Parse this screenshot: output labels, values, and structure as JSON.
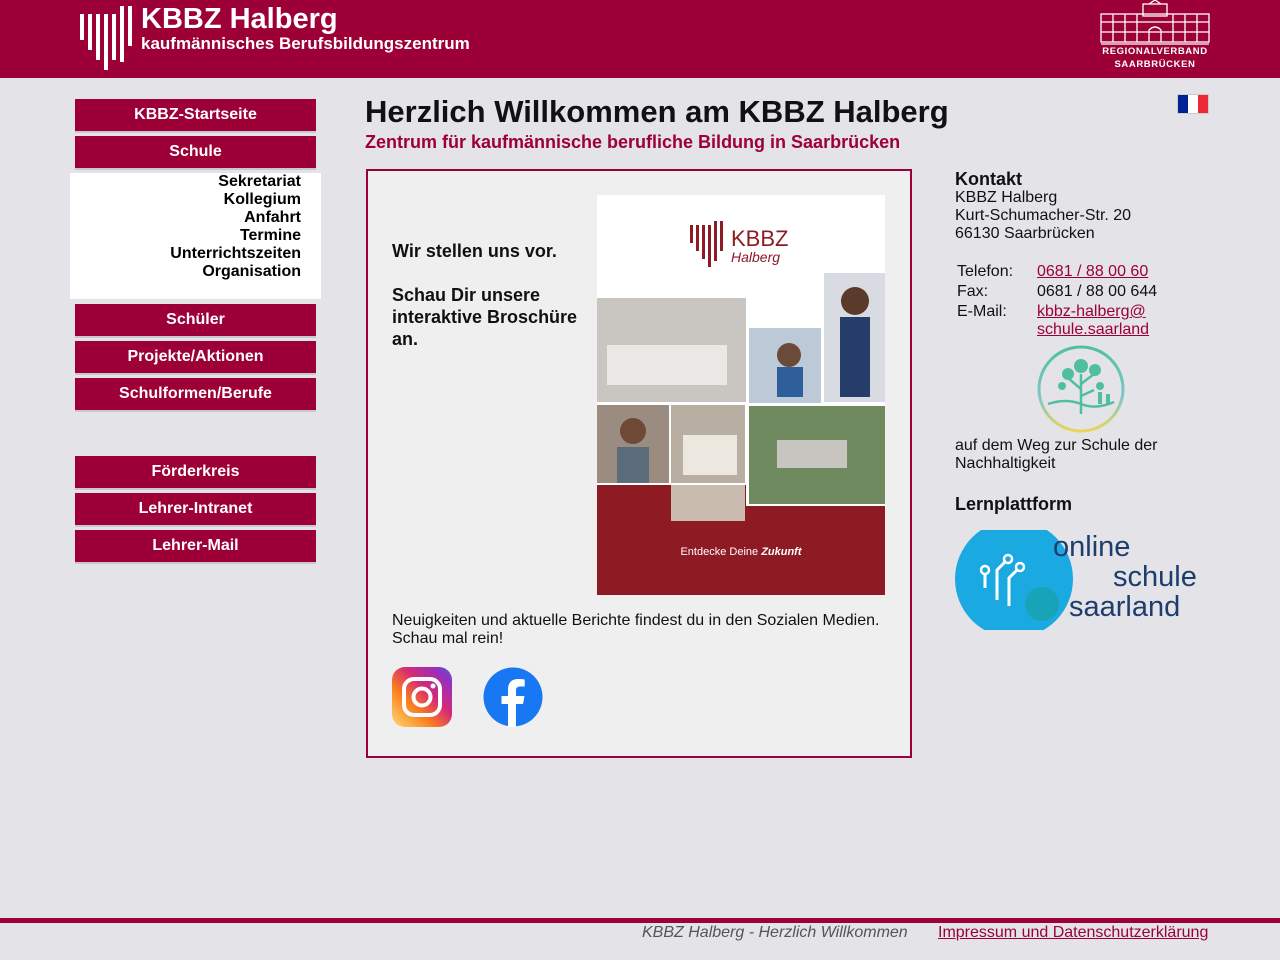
{
  "header": {
    "title": "KBBZ Halberg",
    "subtitle": "kaufmännisches Berufsbildungszentrum",
    "partner_line1": "REGIONALVERBAND",
    "partner_line2": "SAARBRÜCKEN"
  },
  "nav": {
    "startseite": "KBBZ-Startseite",
    "schule": "Schule",
    "schule_sub": [
      "Sekretariat",
      "Kollegium",
      "Anfahrt",
      "Termine",
      "Unterrichtszeiten",
      "Organisation"
    ],
    "schueler": "Schüler",
    "projekte": "Projekte/Aktionen",
    "schulformen": "Schulformen/Berufe",
    "foerderkreis": "Förderkreis",
    "intranet": "Lehrer-Intranet",
    "mail": "Lehrer-Mail"
  },
  "main": {
    "title": "Herzlich Willkommen am KBBZ Halberg",
    "subtitle": "Zentrum für kaufmännische berufliche Bildung in Saarbrücken",
    "intro_1": "Wir stellen uns vor.",
    "intro_2": "Schau Dir unsere interaktive Broschüre an.",
    "brochure_logo_1": "KBBZ",
    "brochure_logo_2": "Halberg",
    "brochure_caption_1": "Entdecke Deine ",
    "brochure_caption_2": "Zukunft",
    "news_text": "Neuigkeiten und aktuelle Berichte findest du in den Sozialen Medien. Schau mal rein!"
  },
  "contact": {
    "heading": "Kontakt",
    "name": "KBBZ Halberg",
    "street": "Kurt-Schumacher-Str. 20",
    "city": "66130 Saarbrücken",
    "phone_label": "Telefon:",
    "phone": "0681 / 88 00 60",
    "fax_label": "Fax:",
    "fax": "0681 / 88 00 644",
    "email_label": "E-Mail:",
    "email_1": "kbbz-halberg@",
    "email_2": "schule.saarland"
  },
  "sustainability": {
    "text": "auf dem Weg zur Schule der Nachhaltigkeit"
  },
  "learning": {
    "heading": "Lernplattform",
    "logo_line1": "online",
    "logo_line2": "schule",
    "logo_line3": "saarland"
  },
  "footer": {
    "left": "KBBZ Halberg - Herzlich Willkommen",
    "right": "Impressum und Datenschutzerklärung"
  },
  "colors": {
    "brand": "#9c0036",
    "background": "#e4e4e8",
    "brochure_red": "#8e1a24"
  },
  "icons": {
    "flag": "french-flag-icon",
    "instagram": "instagram-icon",
    "facebook": "facebook-icon"
  }
}
